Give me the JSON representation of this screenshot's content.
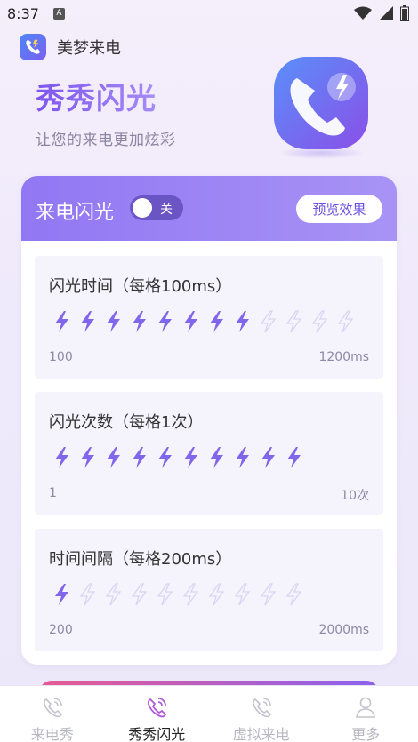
{
  "status": {
    "time": "8:37",
    "a_badge": "A"
  },
  "app": {
    "name": "美梦来电"
  },
  "hero": {
    "title": "秀秀闪光",
    "subtitle": "让您的来电更加炫彩"
  },
  "flash": {
    "title": "来电闪光",
    "toggle_label": "关",
    "toggle_on": false,
    "preview_label": "预览效果",
    "sections": [
      {
        "title": "闪光时间（每格100ms）",
        "min": "100",
        "max": "1200ms",
        "total": 12,
        "active": 8
      },
      {
        "title": "闪光次数（每格1次）",
        "min": "1",
        "max": "10次",
        "total": 10,
        "active": 10
      },
      {
        "title": "时间间隔（每格200ms）",
        "min": "200",
        "max": "2000ms",
        "total": 10,
        "active": 1
      }
    ]
  },
  "nav": {
    "items": [
      {
        "label": "来电秀",
        "icon": "phone-ring-icon",
        "active": false
      },
      {
        "label": "秀秀闪光",
        "icon": "phone-ring-icon",
        "active": true
      },
      {
        "label": "虚拟来电",
        "icon": "phone-ring-icon",
        "active": false
      },
      {
        "label": "更多",
        "icon": "person-icon",
        "active": false
      }
    ]
  },
  "colors": {
    "accent": "#8a6cf2",
    "bolt_active": "#8066ea",
    "bolt_inactive": "#d9d4f3"
  }
}
